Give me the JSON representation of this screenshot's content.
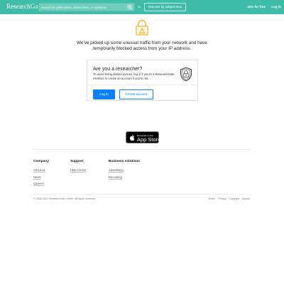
{
  "header": {
    "logo": "ResearchGate",
    "search_placeholder": "Search for publications, researchers, or questions",
    "or_label": "or",
    "discover_label": "Discover by subject area",
    "join_label": "Join for free",
    "login_label": "Log in"
  },
  "notice": {
    "message": "We've picked up some unusual traffic from your network and have temporarily blocked access from your IP address."
  },
  "card": {
    "title": "Are you a researcher?",
    "description": "To avoid being denied access, log in if you're a ResearchGate member or create an account if you're not.",
    "login_label": "Log in",
    "create_label": "Create account"
  },
  "appstore": {
    "small": "Download on the",
    "big": "App Store"
  },
  "footer": {
    "company": {
      "title": "Company",
      "links": [
        "About us",
        "News",
        "Careers"
      ]
    },
    "support": {
      "title": "Support",
      "links": [
        "Help Center"
      ]
    },
    "business": {
      "title": "Business solutions",
      "links": [
        "Advertising",
        "Recruiting"
      ]
    },
    "copyright": "© 2008-2021 ResearchGate GmbH. All rights reserved.",
    "legal": [
      "Terms",
      "Privacy",
      "Copyright",
      "Imprint"
    ]
  },
  "colors": {
    "header_bg": "#40bda8",
    "primary_button": "#0e80ff",
    "lock_icon": "#f0b429"
  },
  "icons": [
    "search-icon",
    "lock-icon",
    "shield-lock-icon",
    "apple-icon"
  ]
}
